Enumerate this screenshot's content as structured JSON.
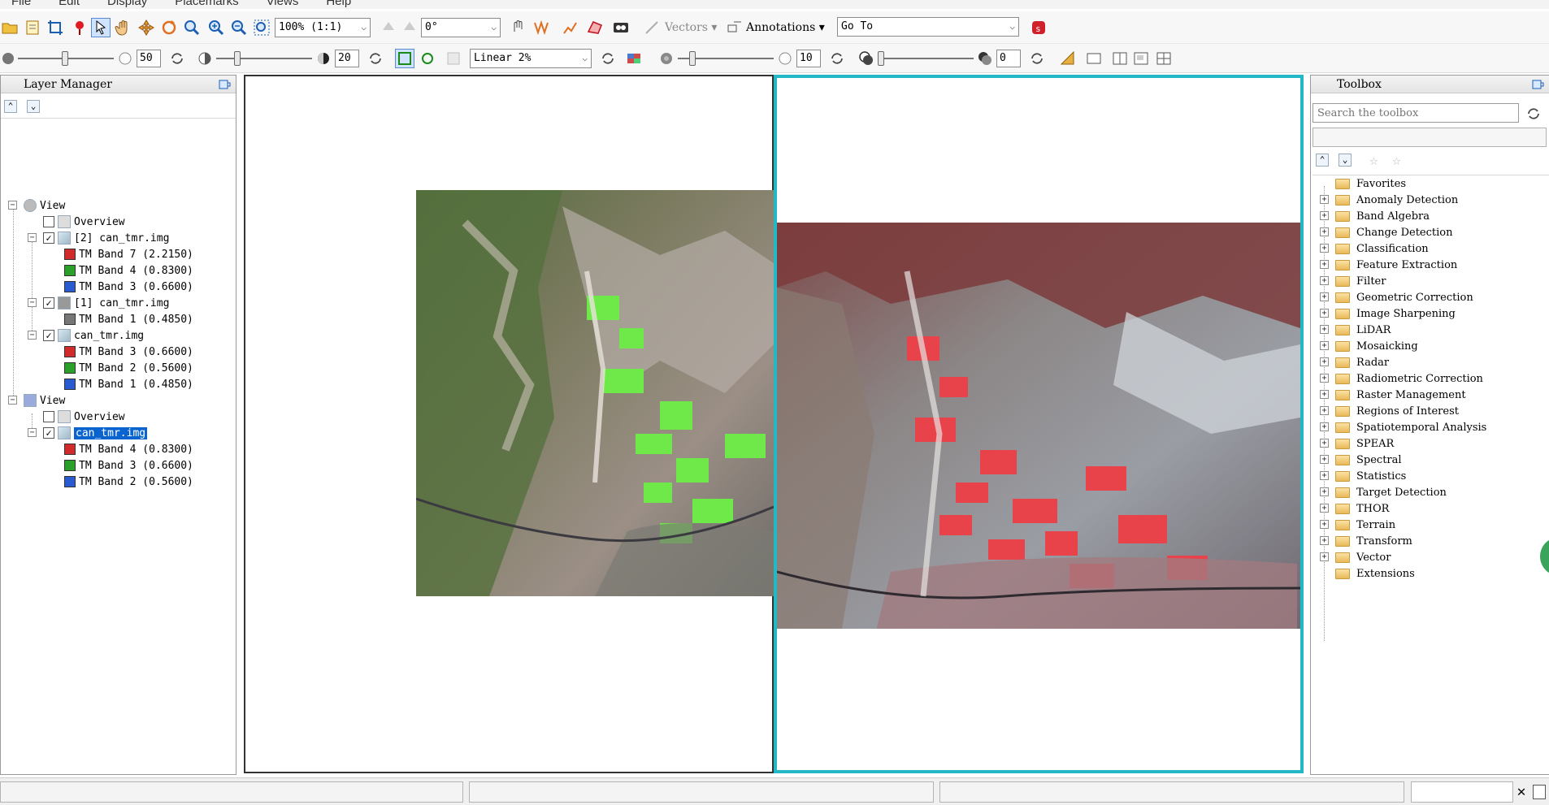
{
  "menubar": {
    "items": [
      "File",
      "Edit",
      "Display",
      "Placemarks",
      "Views",
      "Help"
    ]
  },
  "toolbar1": {
    "zoom_value": "100% (1:1)",
    "rotation_value": "0°",
    "vectors_label": "Vectors",
    "annotations_label": "Annotations",
    "goto_value": "Go To"
  },
  "toolbar2": {
    "brightness_value": "50",
    "contrast_value": "20",
    "stretch_value": "Linear 2%",
    "sharpen_value": "10",
    "transparency_value": "0"
  },
  "layer_manager": {
    "title": "Layer Manager",
    "nodes": [
      {
        "label": "View"
      },
      {
        "label": "Overview"
      },
      {
        "label": "[2] can_tmr.img"
      },
      {
        "label": "TM Band 7 (2.2150)"
      },
      {
        "label": "TM Band 4 (0.8300)"
      },
      {
        "label": "TM Band 3 (0.6600)"
      },
      {
        "label": "[1] can_tmr.img"
      },
      {
        "label": "TM Band 1 (0.4850)"
      },
      {
        "label": "can_tmr.img"
      },
      {
        "label": "TM Band 3 (0.6600)"
      },
      {
        "label": "TM Band 2 (0.5600)"
      },
      {
        "label": "TM Band 1 (0.4850)"
      },
      {
        "label": "View"
      },
      {
        "label": "Overview"
      },
      {
        "label": "can_tmr.img"
      },
      {
        "label": "TM Band 4 (0.8300)"
      },
      {
        "label": "TM Band 3 (0.6600)"
      },
      {
        "label": "TM Band 2 (0.5600)"
      }
    ]
  },
  "toolbox": {
    "title": "Toolbox",
    "search_placeholder": "Search the toolbox",
    "items": [
      "Favorites",
      "Anomaly Detection",
      "Band Algebra",
      "Change Detection",
      "Classification",
      "Feature Extraction",
      "Filter",
      "Geometric Correction",
      "Image Sharpening",
      "LiDAR",
      "Mosaicking",
      "Radar",
      "Radiometric Correction",
      "Raster Management",
      "Regions of Interest",
      "Spatiotemporal Analysis",
      "SPEAR",
      "Spectral",
      "Statistics",
      "Target Detection",
      "THOR",
      "Terrain",
      "Transform",
      "Vector",
      "Extensions"
    ]
  },
  "colors": {
    "active_view_border": "#22b8c6",
    "selection": "#0a64d0"
  }
}
